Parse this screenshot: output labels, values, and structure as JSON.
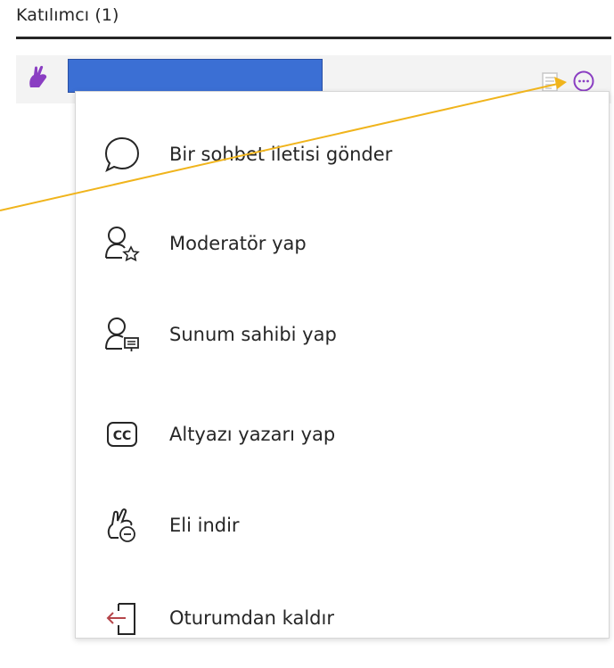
{
  "header": {
    "title": "Katılımcı (1)"
  },
  "participant": {
    "name_redacted": true,
    "hand_icon": "raised-hand-icon",
    "notes_icon": "notes-icon",
    "more_icon": "more-options-icon"
  },
  "menu": {
    "items": [
      {
        "label": "Bir sohbet iletisi gönder",
        "icon": "chat-bubble-icon"
      },
      {
        "label": "Moderatör yap",
        "icon": "user-star-icon"
      },
      {
        "label": "Sunum sahibi yap",
        "icon": "user-presenter-icon"
      },
      {
        "label": "Altyazı yazarı yap",
        "icon": "cc-icon"
      },
      {
        "label": "Eli indir",
        "icon": "lower-hand-icon"
      },
      {
        "label": "Oturumdan kaldır",
        "icon": "remove-session-icon"
      }
    ]
  },
  "colors": {
    "accent_purple": "#8a3ec2",
    "arrow": "#f0b41c",
    "remove_arrow": "#b5454a",
    "name_bar": "#3b6fd4"
  }
}
